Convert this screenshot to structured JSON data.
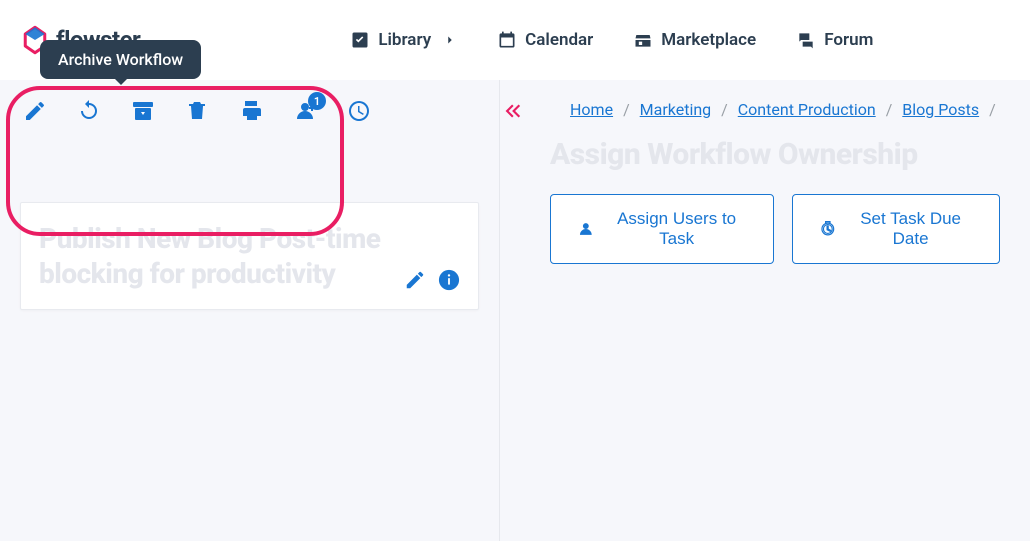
{
  "brand": {
    "name": "flowster"
  },
  "nav": {
    "library": "Library",
    "calendar": "Calendar",
    "marketplace": "Marketplace",
    "forum": "Forum"
  },
  "toolbar": {
    "tooltip": "Archive Workflow",
    "assign_badge": "1"
  },
  "workflow": {
    "title": "Publish New Blog Post-time blocking for productivity"
  },
  "breadcrumb": {
    "home": "Home",
    "l1": "Marketing",
    "l2": "Content Production",
    "l3": "Blog Posts"
  },
  "right": {
    "section_title": "Assign Workflow Ownership",
    "assign_users": "Assign Users to Task",
    "set_due": "Set Task Due Date"
  }
}
